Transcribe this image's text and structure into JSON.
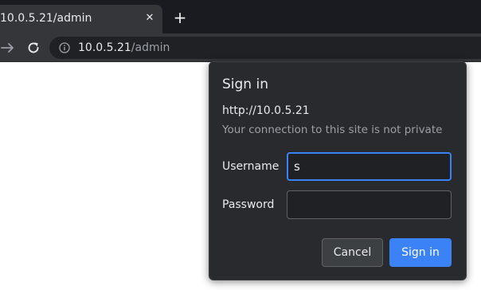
{
  "browser": {
    "tab": {
      "title": "10.0.5.21/admin",
      "close_icon": "close-icon"
    },
    "new_tab_icon": "plus-icon",
    "toolbar": {
      "forward_icon": "arrow-right-icon",
      "reload_icon": "reload-icon",
      "info_icon": "info-icon"
    },
    "omnibox": {
      "host": "10.0.5.21",
      "path": "/admin"
    }
  },
  "auth_dialog": {
    "title": "Sign in",
    "origin": "http://10.0.5.21",
    "warning": "Your connection to this site is not private",
    "username_label": "Username",
    "username_value": "s",
    "password_label": "Password",
    "password_value": "",
    "cancel_label": "Cancel",
    "signin_label": "Sign in"
  },
  "colors": {
    "accent": "#3b82f6",
    "dialog_bg": "#292a2d",
    "toolbar_bg": "#35363a"
  }
}
